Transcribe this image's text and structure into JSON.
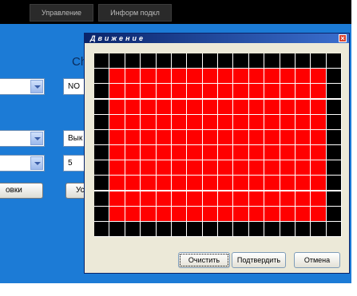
{
  "menu": {
    "tabs": [
      "Управление",
      "Информ подкл"
    ]
  },
  "background": {
    "heading_fragment": "Ch",
    "field_top": "NO",
    "field_middle": "Вык",
    "field_bottom": "5",
    "left_button": "овки",
    "right_button": "Ус"
  },
  "dialog": {
    "title": "Движение",
    "buttons": {
      "clear": "Очистить",
      "confirm": "Подтвердить",
      "cancel": "Отмена"
    },
    "grid": {
      "columns": 16,
      "rows": 12,
      "active_columns": [
        1,
        14
      ],
      "active_rows": [
        1,
        10
      ],
      "active_color": "#ff0000",
      "inactive_color": "#000000"
    }
  },
  "colors": {
    "panel": "#1c7bd6",
    "menubar": "#000000",
    "dialog_title": "#0a246a"
  }
}
